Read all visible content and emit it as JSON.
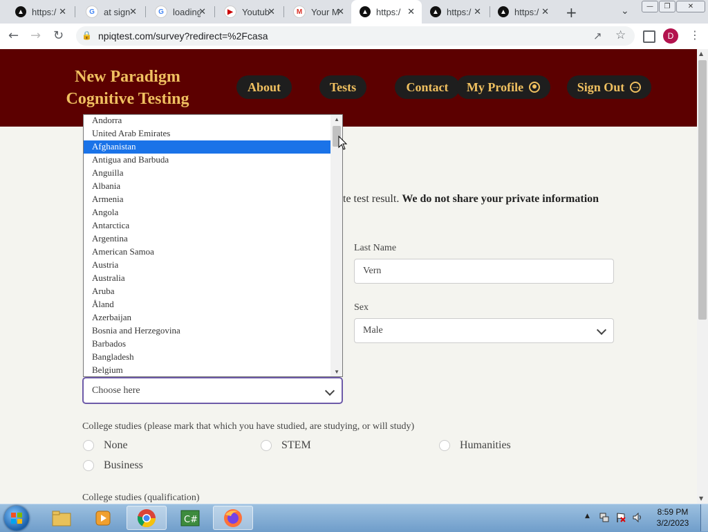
{
  "browser": {
    "tabs": [
      {
        "title": "https:/",
        "icon": "app-icon"
      },
      {
        "title": "at sign",
        "icon": "google-icon"
      },
      {
        "title": "loading",
        "icon": "google-icon"
      },
      {
        "title": "Youtub",
        "icon": "youtube-icon"
      },
      {
        "title": "Your M",
        "icon": "gmail-icon"
      },
      {
        "title": "https:/",
        "icon": "app-icon"
      },
      {
        "title": "https:/",
        "icon": "app-icon"
      },
      {
        "title": "https:/",
        "icon": "app-icon"
      }
    ],
    "active_tab": 5,
    "url": "npiqtest.com/survey?redirect=%2Fcasa",
    "profile_initial": "D"
  },
  "site": {
    "logo_line1": "New Paradigm",
    "logo_line2": "Cognitive Testing",
    "nav": {
      "about": "About",
      "tests": "Tests",
      "contact": "Contact",
      "profile": "My Profile",
      "signout": "Sign Out"
    }
  },
  "form": {
    "intro_partial": "te test result.",
    "intro_bold": "We do not share your private information",
    "last_name_label": "Last Name",
    "last_name_value": "Vern",
    "sex_label": "Sex",
    "sex_value": "Male",
    "country_placeholder": "Choose here",
    "college_label": "College studies (please mark that which you have studied, are studying, or will study)",
    "college_options": [
      "None",
      "STEM",
      "Humanities",
      "Business"
    ],
    "qualification_label": "College studies (qualification)"
  },
  "dropdown": {
    "options": [
      "Andorra",
      "United Arab Emirates",
      "Afghanistan",
      "Antigua and Barbuda",
      "Anguilla",
      "Albania",
      "Armenia",
      "Angola",
      "Antarctica",
      "Argentina",
      "American Samoa",
      "Austria",
      "Australia",
      "Aruba",
      "Åland",
      "Azerbaijan",
      "Bosnia and Herzegovina",
      "Barbados",
      "Bangladesh",
      "Belgium"
    ],
    "selected_index": 2
  },
  "taskbar": {
    "time": "8:59 PM",
    "date": "3/2/2023"
  },
  "colors": {
    "header_bg": "#5c0000",
    "header_text": "#f0c060",
    "selection": "#1a73e8"
  }
}
